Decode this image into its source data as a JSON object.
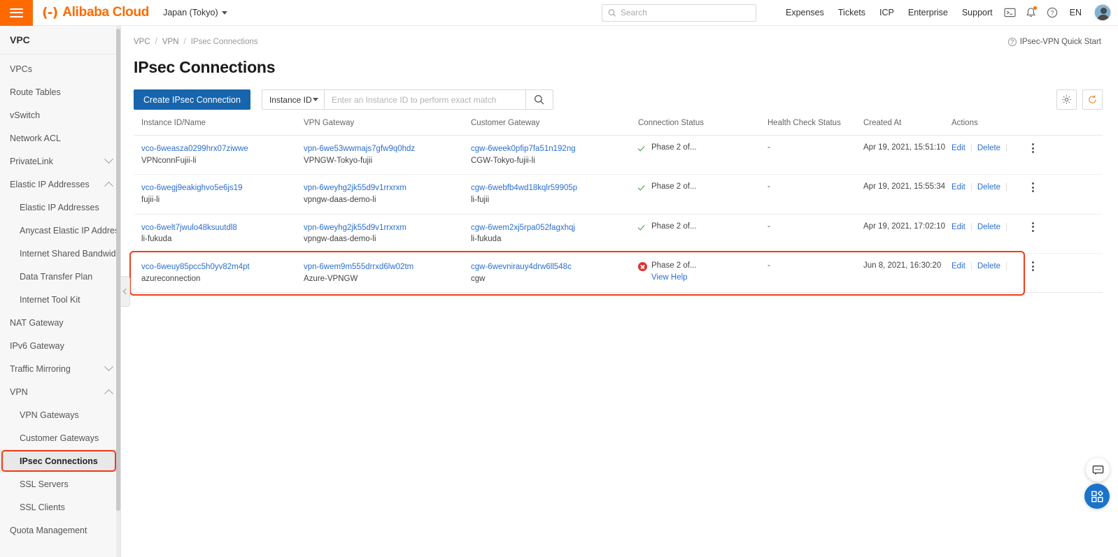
{
  "header": {
    "menu_icon": "hamburger-icon",
    "brand_mark": "(-)",
    "brand_name": "Alibaba Cloud",
    "region": "Japan (Tokyo)",
    "search_placeholder": "Search",
    "search_value": "",
    "links": [
      "Expenses",
      "Tickets",
      "ICP",
      "Enterprise",
      "Support"
    ],
    "language": "EN",
    "icons": [
      "console-terminal-icon",
      "bell-icon",
      "help-circle-icon"
    ]
  },
  "sidebar": {
    "title": "VPC",
    "items": [
      {
        "label": "VPCs",
        "level": 0,
        "expand": ""
      },
      {
        "label": "Route Tables",
        "level": 0,
        "expand": ""
      },
      {
        "label": "vSwitch",
        "level": 0,
        "expand": ""
      },
      {
        "label": "Network ACL",
        "level": 0,
        "expand": ""
      },
      {
        "label": "PrivateLink",
        "level": 0,
        "expand": "down"
      },
      {
        "label": "Elastic IP Addresses",
        "level": 0,
        "expand": "up"
      },
      {
        "label": "Elastic IP Addresses",
        "level": 1,
        "expand": ""
      },
      {
        "label": "Anycast Elastic IP Addresses",
        "level": 1,
        "expand": ""
      },
      {
        "label": "Internet Shared Bandwidth",
        "level": 1,
        "expand": ""
      },
      {
        "label": "Data Transfer Plan",
        "level": 1,
        "expand": ""
      },
      {
        "label": "Internet Tool Kit",
        "level": 1,
        "expand": ""
      },
      {
        "label": "NAT Gateway",
        "level": 0,
        "expand": ""
      },
      {
        "label": "IPv6 Gateway",
        "level": 0,
        "expand": ""
      },
      {
        "label": "Traffic Mirroring",
        "level": 0,
        "expand": "down"
      },
      {
        "label": "VPN",
        "level": 0,
        "expand": "up"
      },
      {
        "label": "VPN Gateways",
        "level": 1,
        "expand": ""
      },
      {
        "label": "Customer Gateways",
        "level": 1,
        "expand": ""
      },
      {
        "label": "IPsec Connections",
        "level": 1,
        "expand": "",
        "selected": true,
        "highlighted": true
      },
      {
        "label": "SSL Servers",
        "level": 1,
        "expand": ""
      },
      {
        "label": "SSL Clients",
        "level": 1,
        "expand": ""
      },
      {
        "label": "Quota Management",
        "level": 0,
        "expand": ""
      }
    ]
  },
  "breadcrumb": {
    "items": [
      "VPC",
      "VPN",
      "IPsec Connections"
    ],
    "separator": "/"
  },
  "quick_start": {
    "label": "IPsec-VPN Quick Start",
    "icon": "question-circle-icon"
  },
  "page_title": "IPsec Connections",
  "toolbar": {
    "create_label": "Create IPsec Connection",
    "filter_field": "Instance ID",
    "search_placeholder": "Enter an Instance ID to perform exact match",
    "search_value": "",
    "search_icon": "magnifier-icon",
    "settings_icon": "gear-icon",
    "refresh_icon": "refresh-icon"
  },
  "table": {
    "columns": [
      "Instance ID/Name",
      "VPN Gateway",
      "Customer Gateway",
      "Connection Status",
      "Health Check Status",
      "Created At",
      "Actions"
    ],
    "rows": [
      {
        "instance_id": "vco-6weasza0299hrx07ziwwe",
        "instance_name": "VPNconnFujii-li",
        "vpn_gateway_id": "vpn-6we53wwmajs7gfw9q0hdz",
        "vpn_gateway_name": "VPNGW-Tokyo-fujii",
        "customer_gateway_id": "cgw-6week0pfip7fa51n192ng",
        "customer_gateway_name": "CGW-Tokyo-fujii-li",
        "status": "Phase 2 of...",
        "status_type": "ok",
        "status_help": "",
        "health_check": "-",
        "created_at": "Apr 19, 2021, 15:51:10",
        "edit_label": "Edit",
        "delete_label": "Delete",
        "highlighted": false
      },
      {
        "instance_id": "vco-6wegj9eakighvo5e6js19",
        "instance_name": "fujii-li",
        "vpn_gateway_id": "vpn-6weyhg2jk55d9v1rrxrxm",
        "vpn_gateway_name": "vpngw-daas-demo-li",
        "customer_gateway_id": "cgw-6webfb4wd18kqlr59905p",
        "customer_gateway_name": "li-fujii",
        "status": "Phase 2 of...",
        "status_type": "ok",
        "status_help": "",
        "health_check": "-",
        "created_at": "Apr 19, 2021, 15:55:34",
        "edit_label": "Edit",
        "delete_label": "Delete",
        "highlighted": false
      },
      {
        "instance_id": "vco-6welt7jwulo48ksuutdl8",
        "instance_name": "li-fukuda",
        "vpn_gateway_id": "vpn-6weyhg2jk55d9v1rrxrxm",
        "vpn_gateway_name": "vpngw-daas-demo-li",
        "customer_gateway_id": "cgw-6wem2xj5rpa052fagxhqj",
        "customer_gateway_name": "li-fukuda",
        "status": "Phase 2 of...",
        "status_type": "ok",
        "status_help": "",
        "health_check": "-",
        "created_at": "Apr 19, 2021, 17:02:10",
        "edit_label": "Edit",
        "delete_label": "Delete",
        "highlighted": false
      },
      {
        "instance_id": "vco-6weuy85pcc5h0yv82m4pt",
        "instance_name": "azureconnection",
        "vpn_gateway_id": "vpn-6wem9m555drrxd6lw02tm",
        "vpn_gateway_name": "Azure-VPNGW",
        "customer_gateway_id": "cgw-6wevnirauy4drw6ll548c",
        "customer_gateway_name": "cgw",
        "status": "Phase 2 of...",
        "status_type": "error",
        "status_help": "View Help",
        "health_check": "-",
        "created_at": "Jun 8, 2021, 16:30:20",
        "edit_label": "Edit",
        "delete_label": "Delete",
        "highlighted": true
      }
    ]
  },
  "floating": {
    "chat_icon": "chat-bubble-icon",
    "apps_icon": "apps-grid-icon"
  },
  "colors": {
    "brand_orange": "#ff6a00",
    "primary_blue": "#1765ad",
    "link_blue": "#2c6fd1",
    "highlight_red": "#f03c18",
    "status_ok_green": "#3c9a3c",
    "status_error_red": "#e03131"
  }
}
